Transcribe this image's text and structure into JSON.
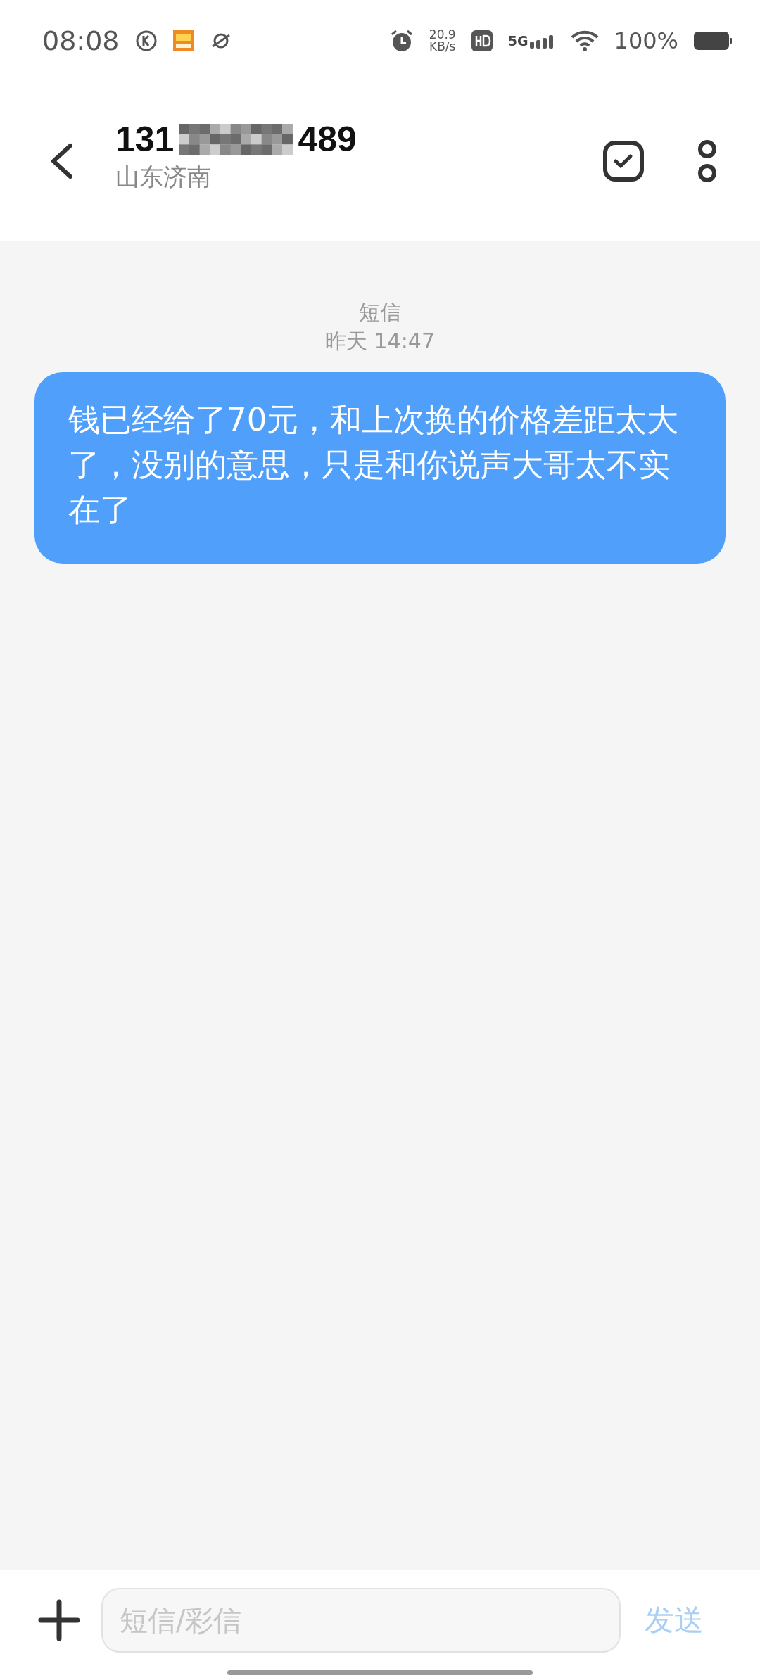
{
  "status_bar": {
    "time": "08:08",
    "speed_value": "20.9",
    "speed_unit": "KB/s",
    "network": "5G",
    "battery": "100%"
  },
  "header": {
    "number_start": "131",
    "number_end": "489",
    "location": "山东济南"
  },
  "conversation": {
    "channel": "短信",
    "timestamp": "昨天 14:47",
    "messages": [
      {
        "text": "钱已经给了70元，和上次换的价格差距太大了，没别的意思，只是和你说声大哥太不实在了",
        "outgoing": true
      }
    ]
  },
  "composer": {
    "placeholder": "短信/彩信",
    "send": {
      "label": "发送",
      "disabled": true
    }
  }
}
